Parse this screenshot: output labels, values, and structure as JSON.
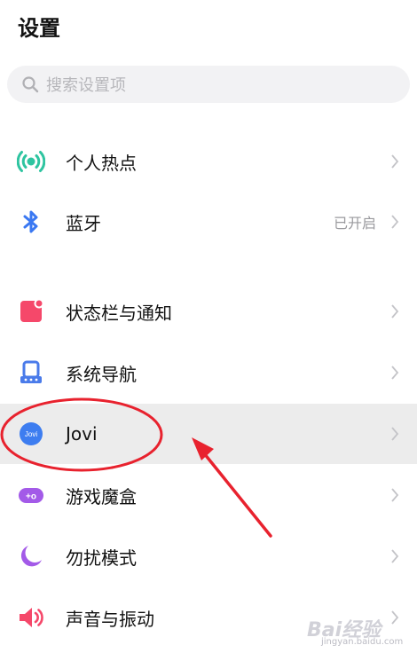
{
  "header": {
    "title": "设置"
  },
  "search": {
    "placeholder": "搜索设置项",
    "icon": "search-icon"
  },
  "items": [
    {
      "label": "个人热点",
      "value": "",
      "icon": "hotspot-icon",
      "color": "#2ec4a0"
    },
    {
      "label": "蓝牙",
      "value": "已开启",
      "icon": "bluetooth-icon",
      "color": "#3a78f2"
    },
    {
      "label": "状态栏与通知",
      "value": "",
      "icon": "notification-icon",
      "color": "#f5486a"
    },
    {
      "label": "系统导航",
      "value": "",
      "icon": "navigation-icon",
      "color": "#4a7bea"
    },
    {
      "label": "Jovi",
      "value": "",
      "icon": "jovi-icon",
      "icon_text": "Jovi",
      "color": "#3d7df0"
    },
    {
      "label": "游戏魔盒",
      "value": "",
      "icon": "game-box-icon",
      "icon_text": "+o",
      "color": "#a35ae8"
    },
    {
      "label": "勿扰模式",
      "value": "",
      "icon": "moon-icon",
      "color": "#a35ae8"
    },
    {
      "label": "声音与振动",
      "value": "",
      "icon": "speaker-icon",
      "color": "#f5486a"
    }
  ],
  "annotation": {
    "color": "#e8222e"
  },
  "watermark": {
    "brand": "Bai经验",
    "url": "jingyan.baidu.com"
  }
}
